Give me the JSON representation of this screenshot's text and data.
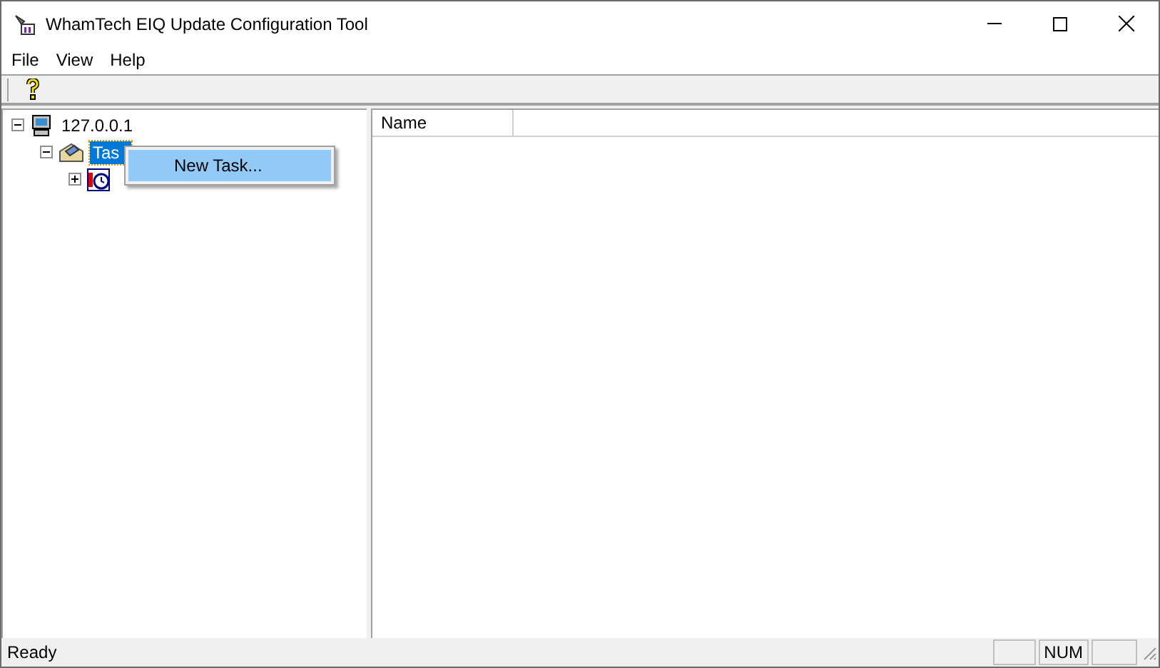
{
  "window": {
    "title": "WhamTech EIQ Update Configuration Tool"
  },
  "menu": [
    "File",
    "View",
    "Help"
  ],
  "tree": [
    {
      "label": "127.0.0.1",
      "expanded": true,
      "children": [
        {
          "label": "Tas",
          "expanded": true,
          "selected": true,
          "children": [
            {
              "expanded": false
            }
          ]
        }
      ]
    }
  ],
  "list": {
    "columns": [
      "Name"
    ]
  },
  "context_menu": {
    "items": [
      {
        "label": "New Task...",
        "selected": true
      }
    ]
  },
  "status_bar": {
    "text": "Ready",
    "panes": [
      "NUM"
    ]
  }
}
